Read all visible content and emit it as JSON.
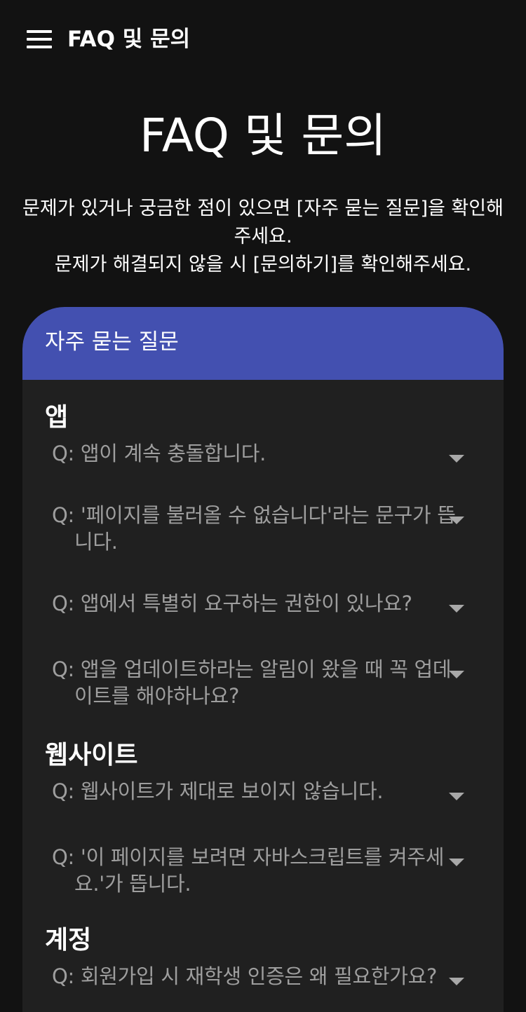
{
  "topbar": {
    "title": "FAQ 및 문의",
    "menu_icon": "hamburger-menu-icon"
  },
  "page": {
    "title": "FAQ 및 문의",
    "intro_line1": "문제가 있거나 궁금한 점이 있으면 [자주 묻는 질문]을 확인해주세요.",
    "intro_line2": "문제가 해결되지 않을 시 [문의하기]를 확인해주세요."
  },
  "faq": {
    "header": "자주 묻는 질문",
    "sections": [
      {
        "title": "앱",
        "questions": [
          "Q: 앱이 계속 충돌합니다.",
          "Q: '페이지를 불러올 수 없습니다'라는 문구가 뜹니다.",
          "Q: 앱에서 특별히 요구하는 권한이 있나요?",
          "Q: 앱을 업데이트하라는 알림이 왔을 때 꼭 업데이트를 해야하나요?"
        ]
      },
      {
        "title": "웹사이트",
        "questions": [
          "Q: 웹사이트가 제대로 보이지 않습니다.",
          "Q: '이 페이지를 보려면 자바스크립트를 켜주세요.'가 뜹니다."
        ]
      },
      {
        "title": "계정",
        "questions": [
          "Q: 회원가입 시 재학생 인증은 왜 필요한가요?"
        ]
      }
    ]
  },
  "colors": {
    "background": "#121212",
    "card": "#202020",
    "accent": "#4350b0",
    "question_text": "#9e9e9e"
  }
}
